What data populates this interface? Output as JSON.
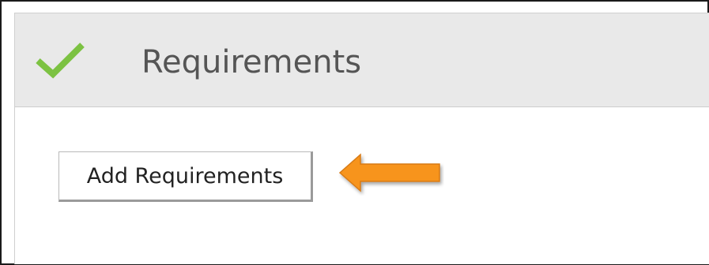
{
  "section": {
    "title": "Requirements",
    "status_icon": "check-icon",
    "status_color": "#7cc242"
  },
  "actions": {
    "add_requirements_label": "Add Requirements"
  },
  "annotation": {
    "icon": "arrow-left-icon",
    "color": "#f7941d"
  }
}
